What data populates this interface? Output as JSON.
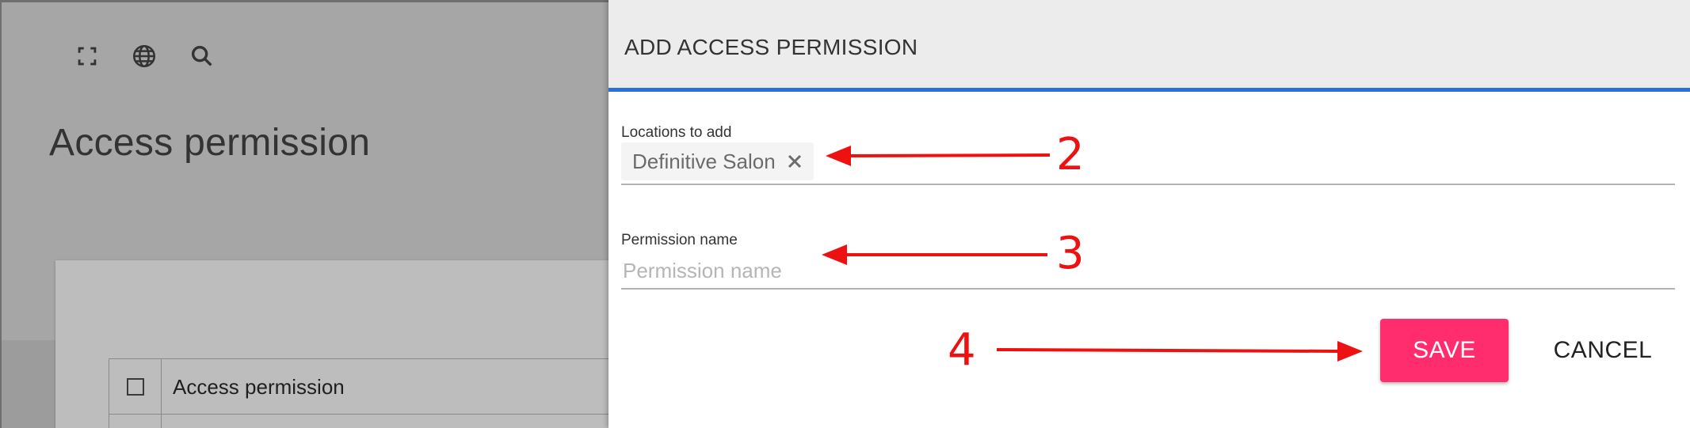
{
  "background": {
    "toolbar": {
      "icons": [
        "fullscreen-icon",
        "globe-icon",
        "search-icon"
      ]
    },
    "page_title": "Access permission",
    "table": {
      "header": "Access permission"
    }
  },
  "dialog": {
    "title": "ADD ACCESS PERMISSION",
    "locations_field": {
      "label": "Locations to add",
      "chips": [
        "Definitive Salon"
      ]
    },
    "permission_field": {
      "label": "Permission name",
      "placeholder": "Permission name",
      "value": ""
    },
    "save_label": "SAVE",
    "cancel_label": "CANCEL"
  },
  "annotations": {
    "numbers": [
      "2",
      "3",
      "4"
    ],
    "color": "#ee1111"
  },
  "colors": {
    "accent": "#2c6fdc",
    "save_button": "#ff2c6e",
    "overlay": "#a6a6a6"
  }
}
